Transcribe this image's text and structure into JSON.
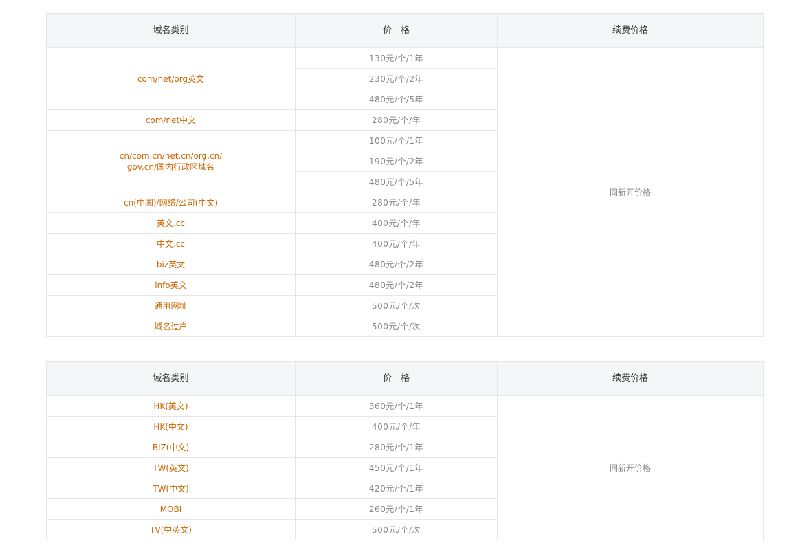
{
  "headers": {
    "category": "域名类别",
    "price": "价　格",
    "renewal": "续费价格"
  },
  "renewal_text": "同新开价格",
  "table1": {
    "groups": [
      {
        "category": "com/net/org英文",
        "prices": [
          "130元/个/1年",
          "230元/个/2年",
          "480元/个/5年"
        ]
      },
      {
        "category": "com/net中文",
        "prices": [
          "280元/个/年"
        ]
      },
      {
        "category_lines": [
          "cn/com.cn/net.cn/org.cn/",
          "gov.cn/国内行政区域名"
        ],
        "prices": [
          "100元/个/1年",
          "190元/个/2年",
          "480元/个/5年"
        ]
      },
      {
        "category": "cn(中国)/网络/公司(中文)",
        "prices": [
          "280元/个/年"
        ]
      },
      {
        "category": "英文.cc",
        "prices": [
          "400元/个/年"
        ]
      },
      {
        "category": "中文.cc",
        "prices": [
          "400元/个/年"
        ]
      },
      {
        "category": "biz英文",
        "prices": [
          "480元/个/2年"
        ]
      },
      {
        "category": "info英文",
        "prices": [
          "480元/个/2年"
        ]
      },
      {
        "category": "通用网址",
        "prices": [
          "500元/个/次"
        ]
      },
      {
        "category": "域名过户",
        "prices": [
          "500元/个/次"
        ]
      }
    ]
  },
  "table2": {
    "groups": [
      {
        "category": "HK(英文)",
        "prices": [
          "360元/个/1年"
        ]
      },
      {
        "category": "HK(中文)",
        "prices": [
          "400元/个/年"
        ]
      },
      {
        "category": "BIZ(中文)",
        "prices": [
          "280元/个/1年"
        ]
      },
      {
        "category": "TW(英文)",
        "prices": [
          "450元/个/1年"
        ]
      },
      {
        "category": "TW(中文)",
        "prices": [
          "420元/个/1年"
        ]
      },
      {
        "category": "MOBI",
        "prices": [
          "260元/个/1年"
        ]
      },
      {
        "category": "TV(中英文)",
        "prices": [
          "500元/个/次"
        ]
      }
    ]
  }
}
